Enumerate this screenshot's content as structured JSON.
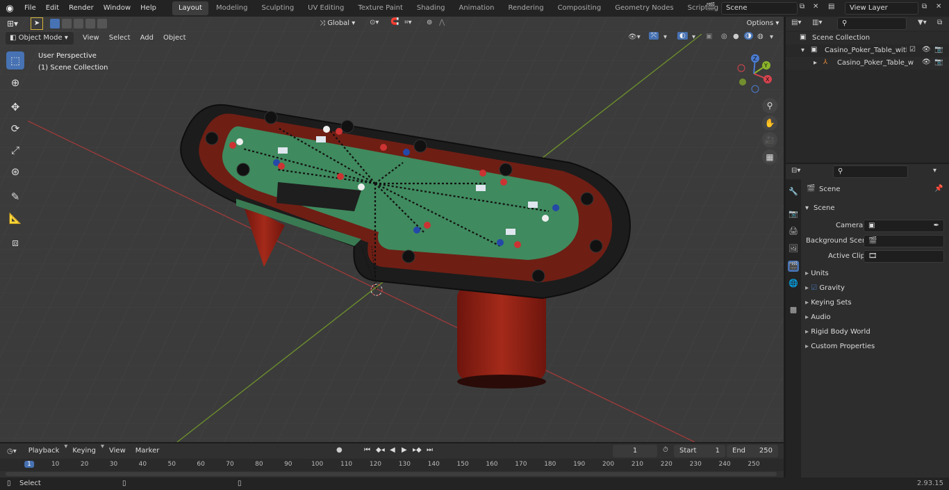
{
  "menu": [
    "File",
    "Edit",
    "Render",
    "Window",
    "Help"
  ],
  "workspaces": [
    {
      "label": "Layout",
      "active": true
    },
    {
      "label": "Modeling"
    },
    {
      "label": "Sculpting"
    },
    {
      "label": "UV Editing"
    },
    {
      "label": "Texture Paint"
    },
    {
      "label": "Shading"
    },
    {
      "label": "Animation"
    },
    {
      "label": "Rendering"
    },
    {
      "label": "Compositing"
    },
    {
      "label": "Geometry Nodes"
    },
    {
      "label": "Scripting"
    }
  ],
  "scene_name": "Scene",
  "view_layer": "View Layer",
  "viewport": {
    "mode": "Object Mode",
    "menus": [
      "View",
      "Select",
      "Add",
      "Object"
    ],
    "transform": "Global",
    "options": "Options",
    "overlay_title": "User Perspective",
    "overlay_sub": "(1) Scene Collection"
  },
  "outliner": {
    "root": "Scene Collection",
    "collection": "Casino_Poker_Table_with_Car",
    "object": "Casino_Poker_Table_with"
  },
  "properties": {
    "header": "Scene",
    "panel": "Scene",
    "camera_label": "Camera",
    "bg_label": "Background Scene",
    "clip_label": "Active Clip",
    "sections": [
      "Units",
      "Gravity",
      "Keying Sets",
      "Audio",
      "Rigid Body World",
      "Custom Properties"
    ]
  },
  "timeline": {
    "menus": [
      "Playback",
      "Keying",
      "View",
      "Marker"
    ],
    "current_frame": "1",
    "start_label": "Start",
    "start": "1",
    "end_label": "End",
    "end": "250",
    "ticks": [
      "1",
      "10",
      "20",
      "30",
      "40",
      "50",
      "60",
      "70",
      "80",
      "90",
      "100",
      "110",
      "120",
      "130",
      "140",
      "150",
      "160",
      "170",
      "180",
      "190",
      "200",
      "210",
      "220",
      "230",
      "240",
      "250"
    ]
  },
  "status": {
    "left": "Select",
    "version": "2.93.15"
  },
  "colors": {
    "accent": "#4772b3",
    "felt": "#3f8a5e",
    "rail": "#1a1a1a",
    "wood": "#8a1f15"
  }
}
